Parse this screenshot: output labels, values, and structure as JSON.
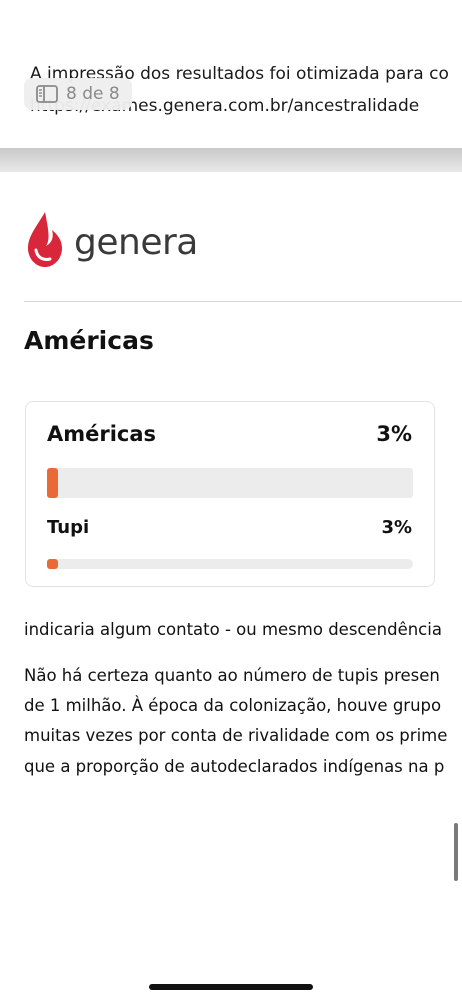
{
  "header": {
    "line1": "A impressão dos resultados foi otimizada para co",
    "line2": "https://exames.genera.com.br/ancestralidade"
  },
  "page_indicator": {
    "label": "8 de 8",
    "icon": "sidebar-doc-icon"
  },
  "brand": {
    "name": "genera",
    "logo_color": "#d8263a",
    "icon": "drop-logo-icon"
  },
  "section": {
    "title": "Américas"
  },
  "card": {
    "region": {
      "name": "Américas",
      "percent_label": "3%",
      "fraction": 0.03
    },
    "subregion": {
      "name": "Tupi",
      "percent_label": "3%",
      "fraction": 0.03
    },
    "bar_color": "#ea6a36"
  },
  "body": {
    "p1": "indicaria algum contato - ou mesmo descendência",
    "p2": [
      "Não há certeza quanto ao número de tupis presen",
      "de 1 milhão. À época da colonização, houve grupo",
      "muitas vezes por conta de rivalidade com os prime",
      "que a proporção de autodeclarados indígenas na p"
    ]
  }
}
